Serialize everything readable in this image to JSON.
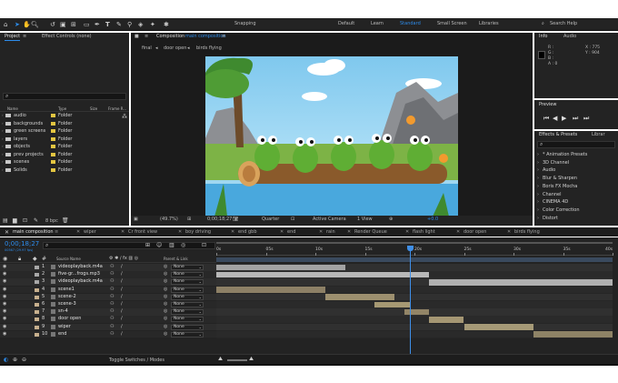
{
  "topbar": {
    "snapping": "Snapping",
    "workspaces": [
      "Default",
      "Learn",
      "Standard",
      "Small Screen",
      "Libraries"
    ],
    "active_workspace": "Standard",
    "search": "Search Help"
  },
  "project_panel": {
    "tabs": [
      "Project",
      "Effect Controls (none)"
    ],
    "columns": [
      "Name",
      "Type",
      "Size",
      "Frame R..."
    ],
    "items": [
      {
        "name": "audio",
        "type": "Folder"
      },
      {
        "name": "backgrounds",
        "type": "Folder"
      },
      {
        "name": "green screens",
        "type": "Folder"
      },
      {
        "name": "layers",
        "type": "Folder"
      },
      {
        "name": "objects",
        "type": "Folder"
      },
      {
        "name": "prev projects",
        "type": "Folder"
      },
      {
        "name": "scenes",
        "type": "Folder"
      },
      {
        "name": "Solids",
        "type": "Folder"
      }
    ],
    "bpc": "8 bpc"
  },
  "composition_panel": {
    "tab_prefix": "Composition",
    "tab_name": "main composition",
    "breadcrumbs": [
      "final",
      "door open",
      "birds flying"
    ],
    "zoom": "(49.7%)",
    "timecode": "0;00;18;27",
    "resolution": "Quarter",
    "camera": "Active Camera",
    "view": "1 View",
    "offset": "+0.0"
  },
  "info_panel": {
    "tabs": [
      "Info",
      "Audio"
    ],
    "r": "R :",
    "g": "G :",
    "b": "B :",
    "a": "A : 0",
    "x": "X : 775",
    "y": "Y : 904"
  },
  "preview_panel": {
    "title": "Preview"
  },
  "effects_panel": {
    "tabs": [
      "Effects & Presets",
      "Librar"
    ],
    "items": [
      "* Animation Presets",
      "3D Channel",
      "Audio",
      "Blur & Sharpen",
      "Boris FX Mocha",
      "Channel",
      "CINEMA 4D",
      "Color Correction",
      "Distort"
    ]
  },
  "timeline_tabs": [
    "main composition",
    "wiper",
    "Cr front view",
    "boy driving",
    "end gbb",
    "end",
    "rain",
    "Render Queue",
    "flash light",
    "door open",
    "birds flying"
  ],
  "timeline": {
    "timecode": "0;00;18;27",
    "timecode_sub": "00567 (29.97 fps)",
    "columns": {
      "source": "Source Name",
      "parent": "Parent & Link"
    },
    "ruler": [
      "0s",
      "05s",
      "10s",
      "15s",
      "20s",
      "25s",
      "30s",
      "35s",
      "40s"
    ],
    "playhead_seconds": 19.5,
    "duration_seconds": 40,
    "layers": [
      {
        "num": "1",
        "name": "videoplayback.m4a",
        "parent": "None",
        "color": "#a8a8a8",
        "bar": {
          "start": 0,
          "end": 13,
          "color": "#a3a3a3"
        }
      },
      {
        "num": "2",
        "name": "five-gr...frogs.mp3",
        "parent": "None",
        "color": "#a8a8a8",
        "bar": {
          "start": 0,
          "end": 21.5,
          "color": "#b8b8b8"
        }
      },
      {
        "num": "3",
        "name": "videoplayback.m4a",
        "parent": "None",
        "color": "#a8a8a8",
        "bar": {
          "start": 21.5,
          "end": 40,
          "color": "#b0b0b0"
        }
      },
      {
        "num": "4",
        "name": "scene1",
        "parent": "None",
        "color": "#c7b08e",
        "bar": {
          "start": 0,
          "end": 11,
          "color": "#8d8066"
        }
      },
      {
        "num": "5",
        "name": "scene-2",
        "parent": "None",
        "color": "#c7b08e",
        "bar": {
          "start": 11,
          "end": 18,
          "color": "#9d906f"
        }
      },
      {
        "num": "6",
        "name": "scene-3",
        "parent": "None",
        "color": "#c7b08e",
        "bar": {
          "start": 16,
          "end": 19.5,
          "color": "#a69973"
        }
      },
      {
        "num": "7",
        "name": "sn-4",
        "parent": "None",
        "color": "#c7b08e",
        "bar": {
          "start": 19,
          "end": 21.5,
          "color": "#938567"
        }
      },
      {
        "num": "8",
        "name": "door open",
        "parent": "None",
        "color": "#c7b08e",
        "bar": {
          "start": 21.5,
          "end": 25,
          "color": "#a49673"
        }
      },
      {
        "num": "9",
        "name": "wiper",
        "parent": "None",
        "color": "#c7b08e",
        "bar": {
          "start": 25,
          "end": 32,
          "color": "#a69a77"
        }
      },
      {
        "num": "10",
        "name": "end",
        "parent": "None",
        "color": "#c7b08e",
        "bar": {
          "start": 32,
          "end": 40,
          "color": "#8e8366"
        }
      }
    ],
    "toggle": "Toggle Switches / Modes"
  }
}
